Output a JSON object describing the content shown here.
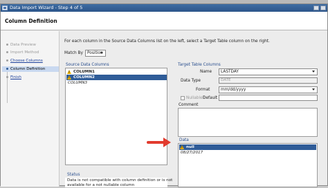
{
  "window": {
    "title": "Data Import Wizard - Step 4 of 5"
  },
  "header": {
    "title": "Column Definition"
  },
  "steps": [
    {
      "label": "Data Preview",
      "state": "done"
    },
    {
      "label": "Import Method",
      "state": "done"
    },
    {
      "label": "Choose Columns",
      "state": "link"
    },
    {
      "label": "Column Definition",
      "state": "current"
    },
    {
      "label": "Finish",
      "state": "link"
    }
  ],
  "intro_text": "For each column in the Source Data Columns list on the left, select a Target Table column on the right.",
  "match_by": {
    "label": "Match By",
    "value": "Position"
  },
  "source_columns": {
    "title": "Source Data Columns",
    "items": [
      {
        "label": "COLUMN1",
        "selected": false,
        "warning": true
      },
      {
        "label": "COLUMN2",
        "selected": true,
        "warning": true
      },
      {
        "label": "COLUMN3",
        "selected": false,
        "warning": false
      }
    ]
  },
  "target_columns": {
    "title": "Target Table Columns",
    "name_label": "Name",
    "name_value": "LASTDAY",
    "data_type_label": "Data Type",
    "data_type_value": "DATE",
    "format_label": "Format",
    "format_value": "mm/dd/yyyy",
    "nullable_label": "Nullable?",
    "default_label": "Default",
    "default_value": "",
    "comment_label": "Comment"
  },
  "data_panel": {
    "title": "Data",
    "rows": [
      {
        "label": "null",
        "selected": true,
        "warning": true
      },
      {
        "label": "08/27/2017",
        "selected": false,
        "warning": false
      }
    ]
  },
  "status": {
    "title": "Status",
    "line1": "Data is not compatible with column definition or is not",
    "line2": "available for a not nullable column"
  },
  "colors": {
    "accent": "#2f5c98",
    "callout_arrow": "#e23b2e",
    "warning": "#f0b400"
  },
  "icons": [
    "wizard-icon",
    "warning-icon",
    "dropdown-arrow-icon",
    "red-callout-arrow"
  ]
}
